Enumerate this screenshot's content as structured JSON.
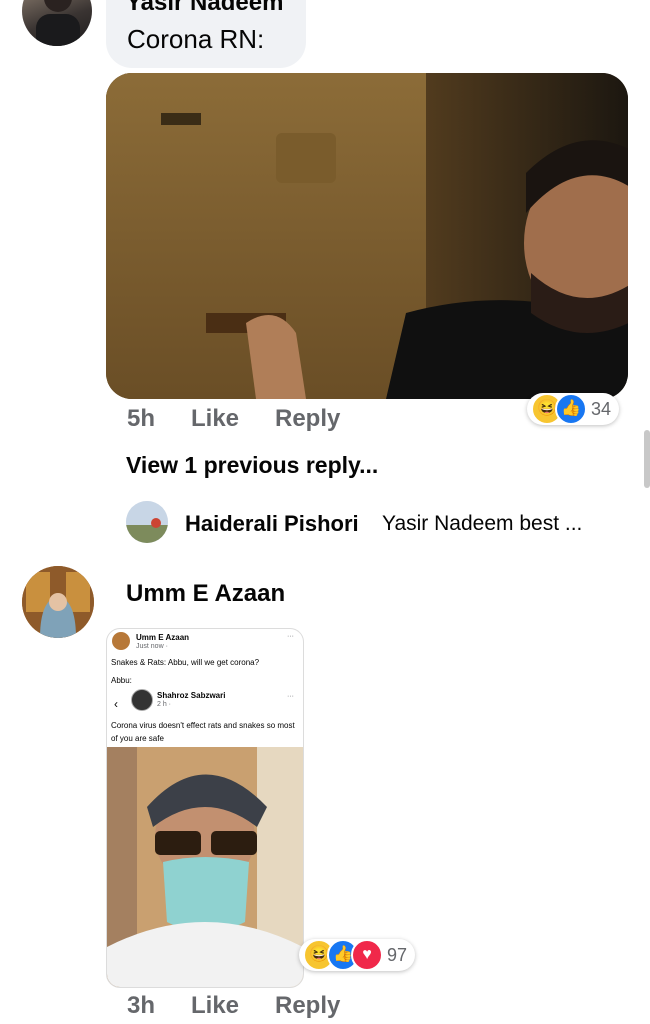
{
  "comment1": {
    "author": "Yasir Nadeem",
    "text": "Corona RN:",
    "time": "5h",
    "like_label": "Like",
    "reply_label": "Reply",
    "reaction_count": "34",
    "reactions": [
      "haha",
      "like"
    ]
  },
  "replies": {
    "view_previous": "View 1 previous reply...",
    "reply_author": "Haiderali Pishori",
    "reply_text": "Yasir Nadeem  best ..."
  },
  "comment2": {
    "author": "Umm E Azaan",
    "time": "3h",
    "like_label": "Like",
    "reply_label": "Reply",
    "reaction_count": "97",
    "reactions": [
      "haha",
      "like",
      "love"
    ],
    "embedded_post": {
      "author": "Umm E Azaan",
      "time": "Just now · ",
      "line1": "Snakes & Rats: Abbu, will we get corona?",
      "line2": "Abbu:",
      "inner_author": "Shahroz Sabzwari",
      "inner_time": "2 h · ",
      "inner_text": "Corona virus doesn't effect rats and snakes so most of you are safe",
      "more": "···"
    }
  },
  "colors": {
    "bubble": "#f0f2f5",
    "meta": "#65676b",
    "like_blue": "#1877f2",
    "love_red": "#f0284a",
    "haha_yellow": "#f7c530"
  }
}
